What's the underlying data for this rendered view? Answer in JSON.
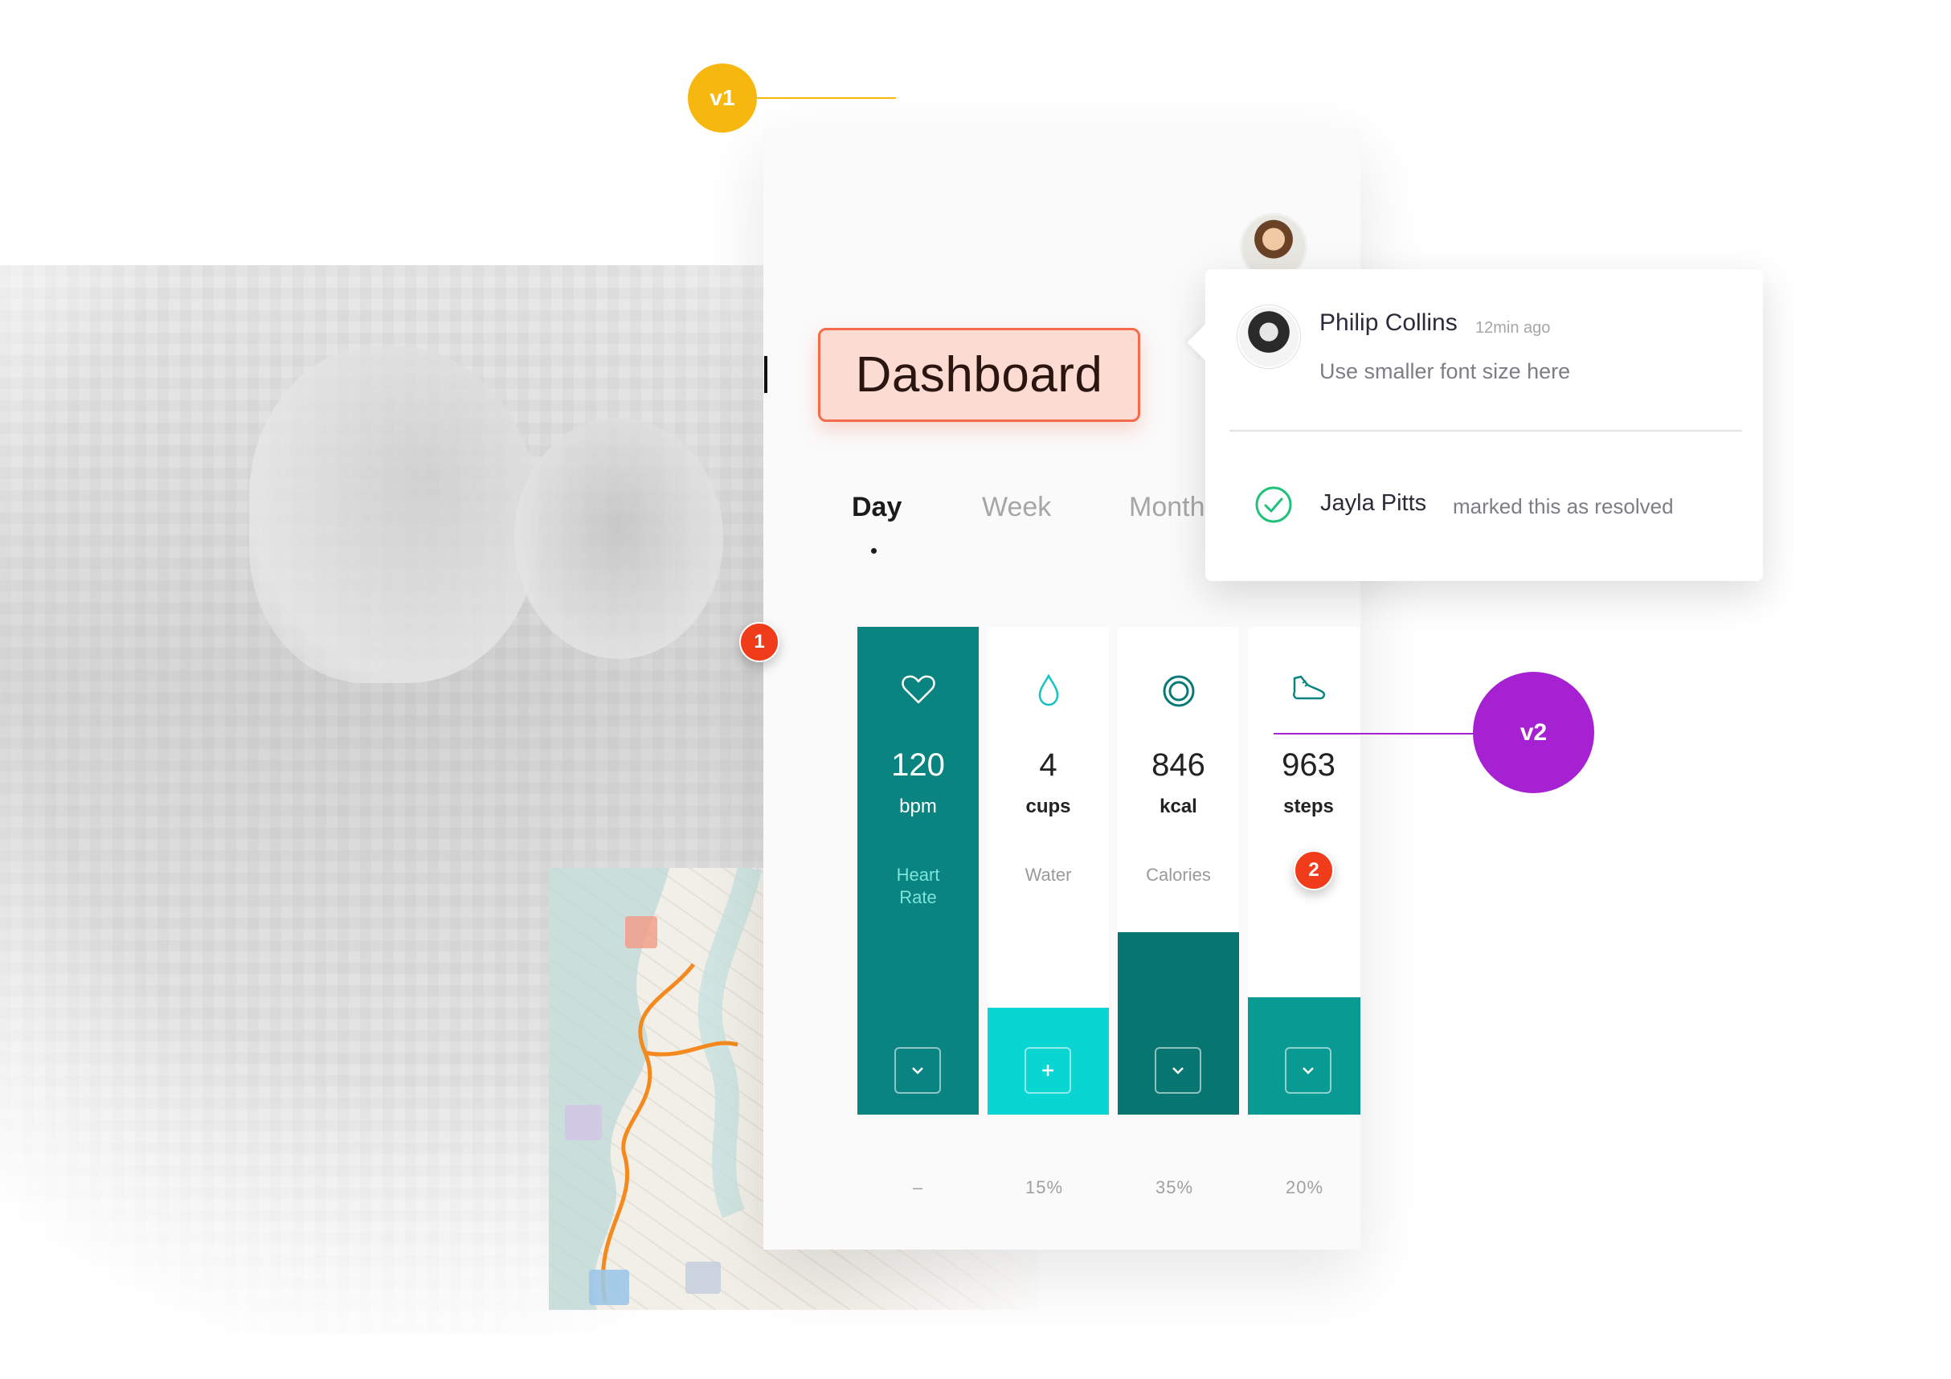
{
  "version_markers": {
    "v1": "v1",
    "v2": "v2"
  },
  "comment_pins": [
    "1",
    "2"
  ],
  "page_title": "Dashboard",
  "tabs": [
    {
      "label": "Day",
      "active": true
    },
    {
      "label": "Week",
      "active": false
    },
    {
      "label": "Month",
      "active": false
    }
  ],
  "metrics": [
    {
      "icon": "heart-icon",
      "value": "120",
      "unit": "bpm",
      "label": "Heart Rate",
      "button_icon": "chevron-down-icon",
      "percent": "–",
      "fill_fraction": 1.0,
      "fill_color": "#0a8480"
    },
    {
      "icon": "water-drop-icon",
      "value": "4",
      "unit": "cups",
      "label": "Water",
      "button_icon": "plus-icon",
      "percent": "15%",
      "fill_fraction": 0.15,
      "fill_color": "#09d6d2"
    },
    {
      "icon": "calories-ring-icon",
      "value": "846",
      "unit": "kcal",
      "label": "Calories",
      "button_icon": "chevron-down-icon",
      "percent": "35%",
      "fill_fraction": 0.35,
      "fill_color": "#077570"
    },
    {
      "icon": "sneaker-icon",
      "value": "963",
      "unit": "steps",
      "label": "",
      "button_icon": "chevron-down-icon",
      "percent": "20%",
      "fill_fraction": 0.2,
      "fill_color": "#0a9a94"
    }
  ],
  "comment": {
    "author": "Philip Collins",
    "time": "12min ago",
    "text": "Use smaller font size here",
    "resolved_by": "Jayla Pitts",
    "resolved_text": "marked this as resolved"
  },
  "colors": {
    "accent_teal": "#0a8480",
    "marker_v1": "#f6b70f",
    "marker_v2": "#a621d2",
    "pin_red": "#f03c1a",
    "title_highlight": "#fcdcd2",
    "resolved_green": "#1fc17b"
  }
}
